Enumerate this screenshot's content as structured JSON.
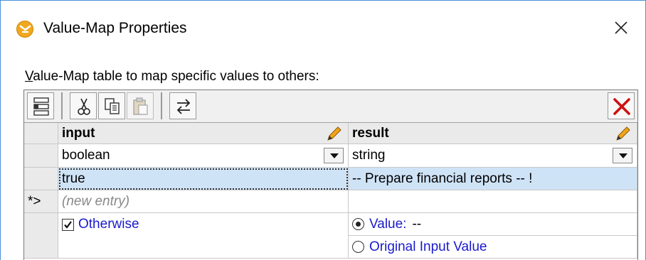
{
  "window": {
    "title": "Value-Map Properties",
    "app_icon": "mapforce-icon",
    "close_icon": "close-icon"
  },
  "caption": {
    "underlined_letter": "V",
    "rest": "alue-Map table to map specific values to others:"
  },
  "toolbar": {
    "buttons": [
      {
        "name": "rows-icon"
      },
      {
        "name": "cut-icon"
      },
      {
        "name": "copy-icon"
      },
      {
        "name": "paste-icon"
      },
      {
        "name": "swap-icon"
      },
      {
        "name": "delete-icon"
      }
    ]
  },
  "table": {
    "headers": {
      "input": "input",
      "result": "result"
    },
    "types": {
      "input": "boolean",
      "result": "string"
    },
    "rows": [
      {
        "marker": "",
        "input": "true",
        "result": "-- Prepare financial reports -- !"
      }
    ],
    "new_entry": {
      "marker": "*>",
      "placeholder": "(new entry)"
    },
    "otherwise": {
      "label": "Otherwise",
      "checked": true,
      "value_label": "Value:",
      "value": "--",
      "original_label": "Original Input Value",
      "selected_option": "value"
    }
  },
  "colors": {
    "selection": "#cfe3f7",
    "link": "#1a1acc",
    "delete": "#d01010",
    "icon_orange": "#f0a81e"
  }
}
